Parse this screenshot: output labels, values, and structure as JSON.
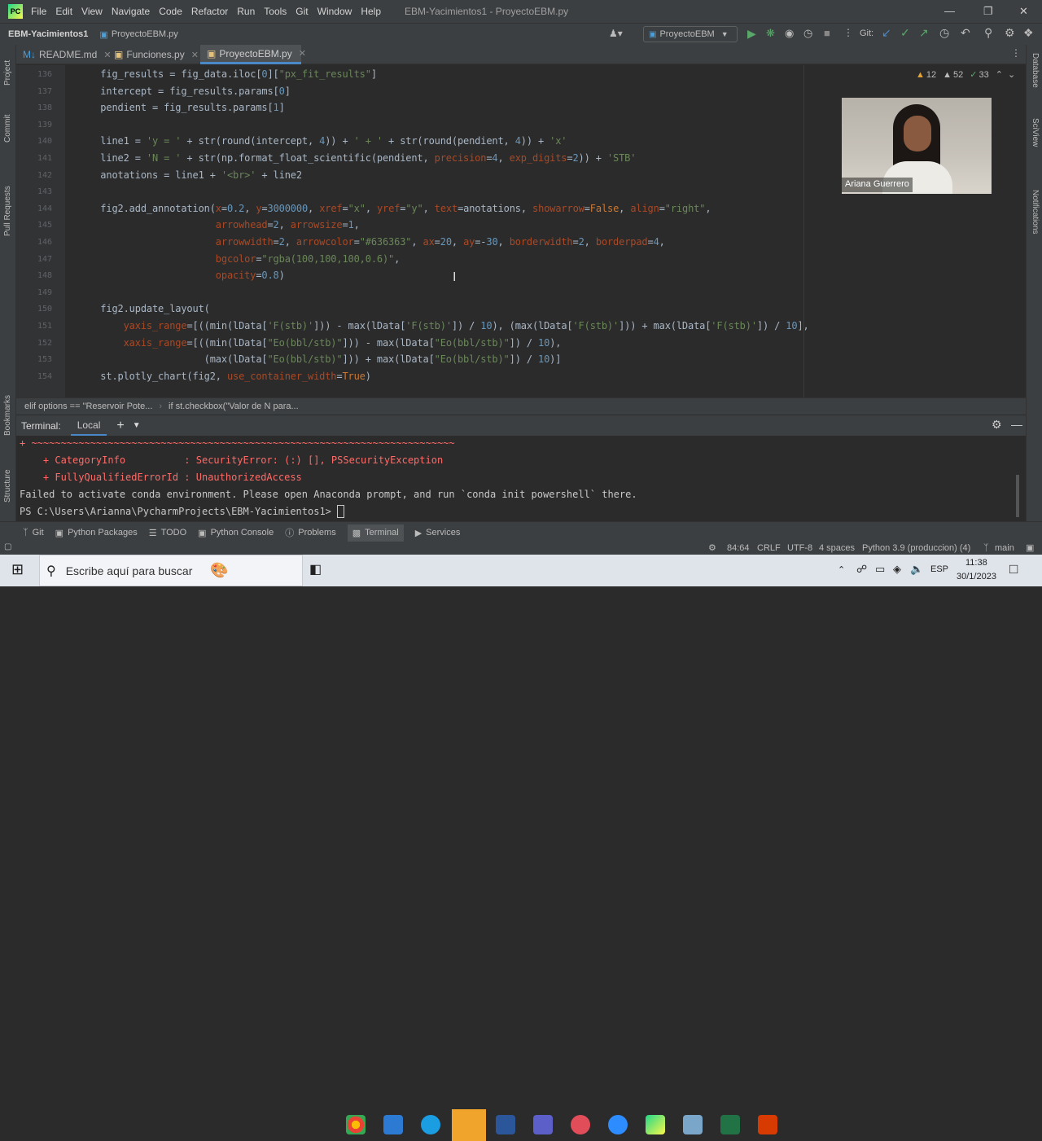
{
  "menu": {
    "items": [
      "File",
      "Edit",
      "View",
      "Navigate",
      "Code",
      "Refactor",
      "Run",
      "Tools",
      "Git",
      "Window",
      "Help"
    ],
    "window_title": "EBM-Yacimientos1 - ProyectoEBM.py"
  },
  "nav": {
    "project": "EBM-Yacimientos1",
    "file": "ProyectoEBM.py",
    "run_config": "ProyectoEBM",
    "git_label": "Git:"
  },
  "tabs": [
    {
      "label": "README.md"
    },
    {
      "label": "Funciones.py"
    },
    {
      "label": "ProyectoEBM.py"
    }
  ],
  "inspections": {
    "warnings": "12",
    "weak": "52",
    "typos": "33"
  },
  "side_labels": {
    "project": "Project",
    "commit": "Commit",
    "pull_requests": "Pull Requests",
    "bookmarks": "Bookmarks",
    "structure": "Structure",
    "database": "Database",
    "sciview": "SciView",
    "notifications": "Notifications"
  },
  "line_numbers": [
    "136",
    "137",
    "138",
    "139",
    "140",
    "141",
    "142",
    "143",
    "144",
    "145",
    "146",
    "147",
    "148",
    "149",
    "150",
    "151",
    "152",
    "153",
    "154"
  ],
  "code_lines": [
    "    fig_results = fig_data.iloc[0][\"px_fit_results\"]",
    "    intercept = fig_results.params[0]",
    "    pendient = fig_results.params[1]",
    "",
    "    line1 = 'y = ' + str(round(intercept, 4)) + ' + ' + str(round(pendient, 4)) + 'x'",
    "    line2 = 'N = ' + str(np.format_float_scientific(pendient, precision=4, exp_digits=2)) + 'STB'",
    "    anotations = line1 + '<br>' + line2",
    "",
    "    fig2.add_annotation(x=0.2, y=3000000, xref=\"x\", yref=\"y\", text=anotations, showarrow=False, align=\"right\",",
    "                        arrowhead=2, arrowsize=1,",
    "                        arrowwidth=2, arrowcolor=\"#636363\", ax=20, ay=-30, borderwidth=2, borderpad=4,",
    "                        bgcolor=\"rgba(100,100,100,0.6)\",",
    "                        opacity=0.8)",
    "",
    "    fig2.update_layout(",
    "        yaxis_range=[((min(lData['F(stb)'])) - max(lData['F(stb)']) / 10), (max(lData['F(stb)'])) + max(lData['F(stb)']) / 10],",
    "        xaxis_range=[((min(lData[\"Eo(bbl/stb)\"])) - max(lData[\"Eo(bbl/stb)\"]) / 10),",
    "                      (max(lData[\"Eo(bbl/stb)\"])) + max(lData[\"Eo(bbl/stb)\"]) / 10)]",
    "    st.plotly_chart(fig2, use_container_width=True)"
  ],
  "breadcrumb": [
    "elif options == \"Reservoir Pote...",
    "if st.checkbox(\"Valor de N para..."
  ],
  "terminal": {
    "title": "Terminal:",
    "tab": "Local",
    "lines": [
      "+ ~~~~~~~~~~~~~~~~~~~~~~~~~~~~~~~~~~~~~~~~~~~~~~~~~~~~~~~~~~~~~~~~~~~~~~~~",
      "    + CategoryInfo          : SecurityError: (:) [], PSSecurityException",
      "    + FullyQualifiedErrorId : UnauthorizedAccess",
      "Failed to activate conda environment. Please open Anaconda prompt, and run `conda init powershell` there.",
      "PS C:\\Users\\Arianna\\PycharmProjects\\EBM-Yacimientos1> "
    ]
  },
  "bottom_tools": [
    "Git",
    "Python Packages",
    "TODO",
    "Python Console",
    "Problems",
    "Terminal",
    "Services"
  ],
  "status": {
    "position": "84:64",
    "line_sep": "CRLF",
    "encoding": "UTF-8",
    "indent": "4 spaces",
    "interpreter": "Python 3.9 (produccion) (4)",
    "branch": "main"
  },
  "video": {
    "name": "Ariana Guerrero"
  },
  "taskbar": {
    "search_placeholder": "Escribe aquí para buscar",
    "lang": "ESP",
    "time": "11:38",
    "date": "30/1/2023"
  }
}
